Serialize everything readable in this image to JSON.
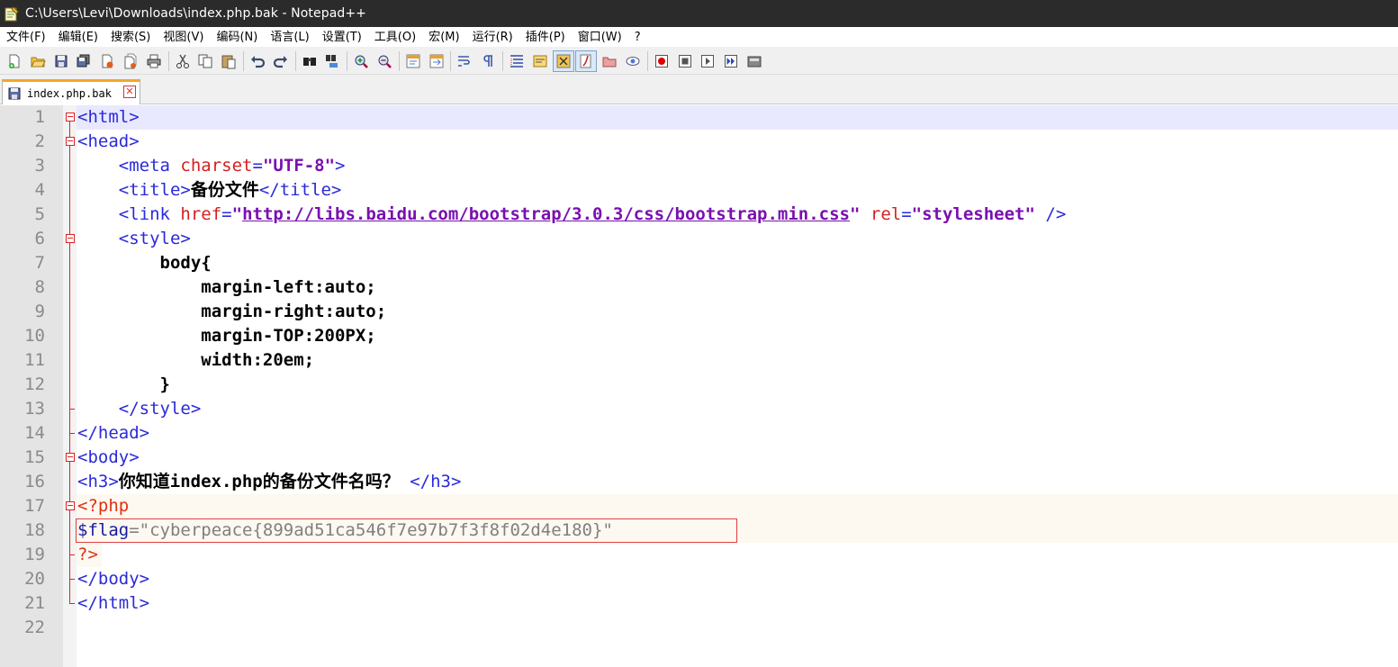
{
  "window": {
    "title": "C:\\Users\\Levi\\Downloads\\index.php.bak - Notepad++"
  },
  "menu": {
    "items": [
      "文件(F)",
      "编辑(E)",
      "搜索(S)",
      "视图(V)",
      "编码(N)",
      "语言(L)",
      "设置(T)",
      "工具(O)",
      "宏(M)",
      "运行(R)",
      "插件(P)",
      "窗口(W)",
      "?"
    ]
  },
  "toolbar": {
    "icons": [
      "new-file-icon",
      "open-file-icon",
      "save-icon",
      "save-all-icon",
      "close-icon",
      "close-all-icon",
      "print-icon",
      "cut-icon",
      "copy-icon",
      "paste-icon",
      "undo-icon",
      "redo-icon",
      "find-icon",
      "replace-icon",
      "zoom-in-icon",
      "zoom-out-icon",
      "sync-vertical-icon",
      "sync-horizontal-icon",
      "word-wrap-icon",
      "show-all-chars-icon",
      "indent-guide-icon",
      "doc-map-icon",
      "function-list-icon",
      "folder-workspace-icon",
      "monitoring-icon",
      "record-macro-icon",
      "stop-macro-icon",
      "play-macro-icon",
      "run-macro-multiple-icon",
      "save-macro-icon"
    ]
  },
  "tab": {
    "label": "index.php.bak",
    "close": "✕"
  },
  "editor": {
    "line_numbers": [
      "1",
      "2",
      "3",
      "4",
      "5",
      "6",
      "7",
      "8",
      "9",
      "10",
      "11",
      "12",
      "13",
      "14",
      "15",
      "16",
      "17",
      "18",
      "19",
      "20",
      "21",
      "22"
    ],
    "lines": {
      "l1": "<html>",
      "l2": "<head>",
      "l3_open": "<meta ",
      "l3_attr": "charset",
      "l3_eq": "=",
      "l3_val": "\"UTF-8\"",
      "l3_close": ">",
      "l4_open": "<title>",
      "l4_text": "备份文件",
      "l4_close": "</title>",
      "l5_open": "<link ",
      "l5_attr1": "href",
      "l5_eq1": "=",
      "l5_q1": "\"",
      "l5_url": "http://libs.baidu.com/bootstrap/3.0.3/css/bootstrap.min.css",
      "l5_q2": "\" ",
      "l5_attr2": "rel",
      "l5_eq2": "=",
      "l5_val2": "\"stylesheet\"",
      "l5_close": " />",
      "l6": "<style>",
      "l7": "body{",
      "l8": "margin-left:auto;",
      "l9": "margin-right:auto;",
      "l10": "margin-TOP:200PX;",
      "l11": "width:20em;",
      "l12": "}",
      "l13": "</style>",
      "l14": "</head>",
      "l15": "<body>",
      "l16_open": "<h3>",
      "l16_text1": "你知道",
      "l16_text2": "index.php",
      "l16_text3": "的备份文件名吗？",
      "l16_close": " </h3>",
      "l17": "<?php",
      "l18_var": "$flag",
      "l18_eq": "=",
      "l18_str": "\"cyberpeace{899ad51ca546f7e97b7f3f8f02d4e180}\"",
      "l19": "?>",
      "l20": "</body>",
      "l21": "</html>"
    }
  },
  "colors": {
    "tag": "#2a2adb",
    "attribute": "#d42020",
    "value": "#7a10b0",
    "php_delimiter": "#e03010",
    "flag_highlight_border": "#e04040",
    "current_line": "#e8e8ff",
    "tab_accent": "#f5a623"
  }
}
